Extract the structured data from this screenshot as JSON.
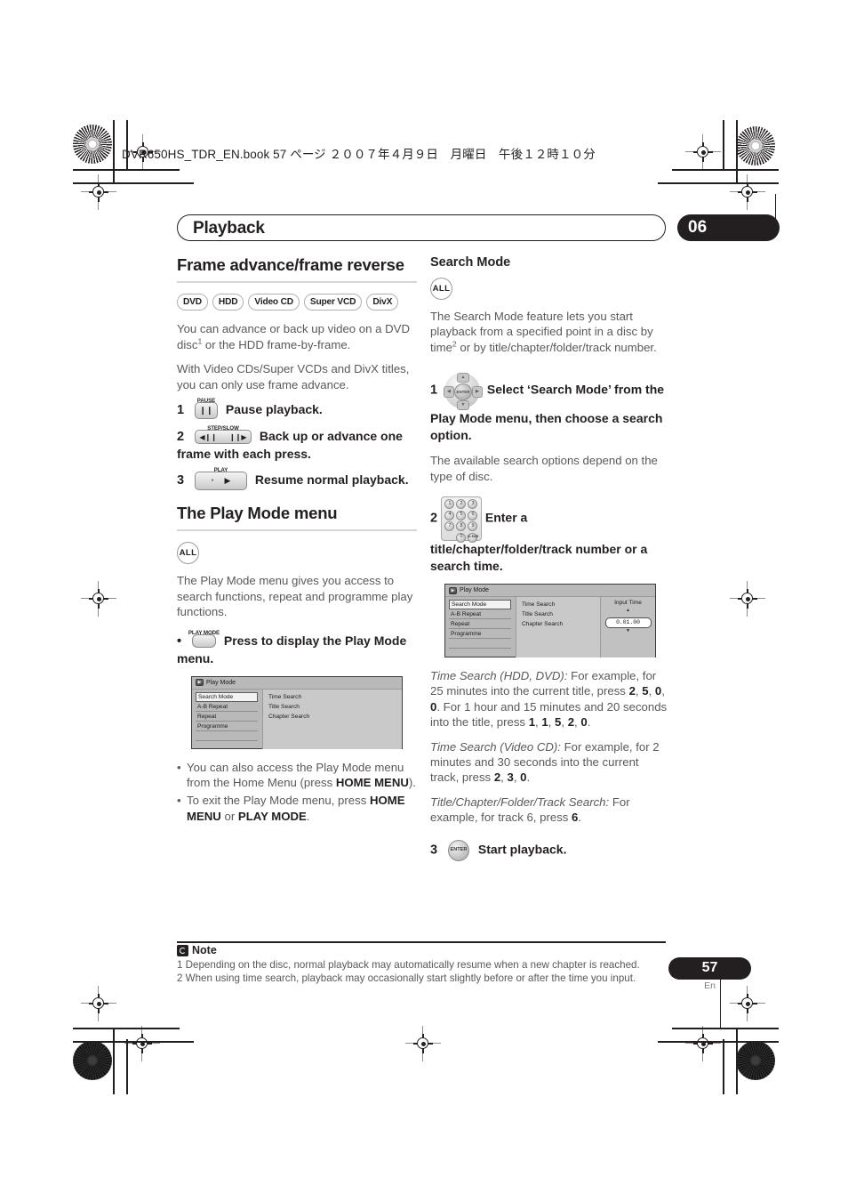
{
  "print_header": {
    "book_line": "DVR650HS_TDR_EN.book  57 ページ  ２００７年４月９日　月曜日　午後１２時１０分"
  },
  "chapter": {
    "title": "Playback",
    "number": "06"
  },
  "left_column": {
    "section_title": "Frame advance/frame reverse",
    "disc_badges": [
      "DVD",
      "HDD",
      "Video CD",
      "Super VCD",
      "DivX"
    ],
    "intro_1": "You can advance or back up video on a DVD disc",
    "intro_1_sup": "1",
    "intro_1_cont": " or the HDD frame-by-frame.",
    "intro_2": "With Video CDs/Super VCDs and DivX titles, you can only use frame advance.",
    "steps": [
      {
        "num": "1",
        "key_label": "PAUSE",
        "key_glyph": "❙❙",
        "text": "Pause playback."
      },
      {
        "num": "2",
        "key_label": "STEP/SLOW",
        "key_glyph_left": "◀❙❙",
        "key_glyph_right": "❙❙▶",
        "text": "Back up or advance one frame with each press."
      },
      {
        "num": "3",
        "key_label": "PLAY",
        "key_glyph": "▶",
        "text": "Resume normal playback."
      }
    ],
    "section_title_2": "The Play Mode menu",
    "badge_all": "ALL",
    "play_mode_intro": "The Play Mode menu gives you access to search functions, repeat and programme play functions.",
    "press_step": {
      "bullet": "•",
      "key_label": "PLAY MODE",
      "text": "Press to display the Play Mode menu."
    },
    "osd": {
      "title": "Play Mode",
      "items": [
        "Search Mode",
        "A-B Repeat",
        "Repeat",
        "Programme"
      ],
      "selected_item": "Search Mode",
      "options": [
        "Time Search",
        "Title Search",
        "Chapter Search"
      ]
    },
    "bullets": [
      {
        "text_before": "You can also access the Play Mode menu from the Home Menu (press ",
        "bold": "HOME MENU",
        "text_after": ")."
      },
      {
        "text_before": "To exit the Play Mode menu, press ",
        "bold": "HOME MENU",
        "mid": " or ",
        "bold2": "PLAY MODE",
        "text_after": "."
      }
    ]
  },
  "right_column": {
    "section_title": "Search Mode",
    "badge_all": "ALL",
    "intro_a": "The Search Mode feature lets you start playback from a specified point in a disc by time",
    "intro_sup": "2",
    "intro_b": " or by title/chapter/folder/track number.",
    "step1": {
      "num": "1",
      "key_label": "ENTER",
      "text": "Select ‘Search Mode’ from the Play Mode menu, then choose a search option.",
      "sub": "The available search options depend on the type of disc."
    },
    "keypad": {
      "keys": [
        "1",
        "2",
        "3",
        "4",
        "5",
        "6",
        "7",
        "8",
        "9",
        "0"
      ],
      "clear_key": "CLEAR"
    },
    "step2": {
      "num": "2",
      "text": "Enter a title/chapter/folder/track number or a search time."
    },
    "osd": {
      "title": "Play Mode",
      "items": [
        "Search Mode",
        "A-B Repeat",
        "Repeat",
        "Programme"
      ],
      "selected_item": "Search Mode",
      "options": [
        "Time Search",
        "Title Search",
        "Chapter Search"
      ],
      "selected_option": "Time Search",
      "input_label": "Input Time",
      "input_value": "0.01.00",
      "up_arrow": "▲",
      "down_arrow": "▼"
    },
    "time_search_hdd": {
      "label": "Time Search (HDD, DVD):",
      "t1": " For example, for 25 minutes into the current title, press ",
      "keys1": [
        "2",
        "5",
        "0",
        "0"
      ],
      "t2": ". For 1 hour and 15 minutes and 20 seconds into the title, press ",
      "keys2": [
        "1",
        "1",
        "5",
        "2",
        "0"
      ],
      "t3": "."
    },
    "time_search_vcd": {
      "label": "Time Search (Video CD):",
      "t1": " For example, for 2 minutes and 30 seconds into the current track, press ",
      "keys1": [
        "2",
        "3",
        "0"
      ],
      "t2": "."
    },
    "tcft_search": {
      "label": "Title/Chapter/Folder/Track Search:",
      "t1": " For example, for track 6, press ",
      "keys1": [
        "6"
      ],
      "t2": "."
    },
    "step3": {
      "num": "3",
      "key_label": "ENTER",
      "text": "Start playback."
    }
  },
  "footer": {
    "note_title": "Note",
    "notes": [
      "1 Depending on the disc, normal playback may automatically resume when a new chapter is reached.",
      "2 When using time search, playback may occasionally start slightly before or after the time you input."
    ],
    "page_number": "57",
    "language": "En"
  }
}
